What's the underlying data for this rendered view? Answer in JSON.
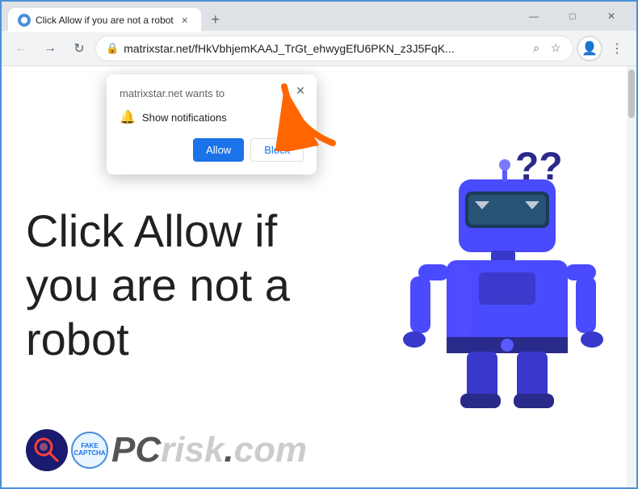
{
  "browser": {
    "tab": {
      "title": "Click Allow if you are not a robot",
      "favicon_label": "favicon"
    },
    "new_tab_label": "+",
    "window_controls": {
      "minimize": "—",
      "maximize": "□",
      "close": "✕"
    },
    "toolbar": {
      "back_label": "←",
      "forward_label": "→",
      "reload_label": "↻",
      "address": "matrixstar.net/fHkVbhjemKAAJ_TrGt_ehwygEfU6PKN_z3J5FqK...",
      "lock_icon": "🔒",
      "search_icon": "⌕",
      "bookmark_icon": "☆",
      "profile_icon": "👤",
      "menu_icon": "⋮"
    },
    "notification_popup": {
      "title": "matrixstar.net wants to",
      "notification_text": "Show notifications",
      "close_label": "✕",
      "allow_label": "Allow",
      "block_label": "Block"
    },
    "page": {
      "main_text": "Click Allow if\nyou are not a\nrobot",
      "pcrisk_label": "PC",
      "risk_label": "risk",
      "com_label": ".com",
      "fc_label": "FAKE\nCAPTCHA"
    }
  }
}
